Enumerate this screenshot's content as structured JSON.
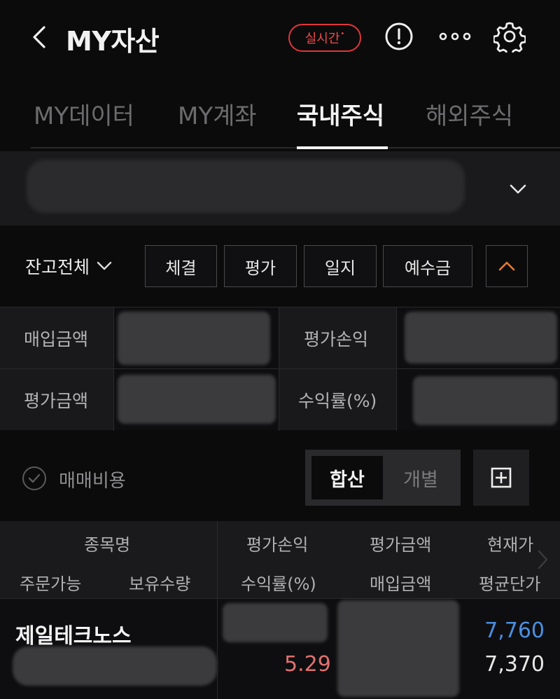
{
  "header": {
    "title": "MY자산",
    "live_label": "실시간",
    "live_dot": "•"
  },
  "tabs": [
    {
      "label": "MY데이터",
      "active": false
    },
    {
      "label": "MY계좌",
      "active": false
    },
    {
      "label": "국내주식",
      "active": true
    },
    {
      "label": "해외주식",
      "active": false
    }
  ],
  "filter": {
    "balance_select": "잔고전체",
    "buttons": [
      "체결",
      "평가",
      "일지",
      "예수금"
    ]
  },
  "summary": {
    "purchase_amount_label": "매입금액",
    "eval_pl_label": "평가손익",
    "eval_amount_label": "평가금액",
    "return_rate_label": "수익률(%)"
  },
  "cost": {
    "label": "매매비용",
    "seg_combined": "합산",
    "seg_individual": "개별"
  },
  "table": {
    "headers_top": [
      "종목명",
      "평가손익",
      "평가금액",
      "현재가"
    ],
    "headers_bottom": [
      "주문가능",
      "보유수량",
      "수익률(%)",
      "매입금액",
      "평균단가"
    ],
    "rows": [
      {
        "name": "제일테크노스",
        "return_rate": "5.29",
        "current_price": "7,760",
        "avg_price": "7,370"
      }
    ]
  },
  "colors": {
    "accent_red": "#e0363a",
    "price_blue": "#4a90e2",
    "up_red": "#e07070",
    "collapse_orange": "#e8772e"
  }
}
